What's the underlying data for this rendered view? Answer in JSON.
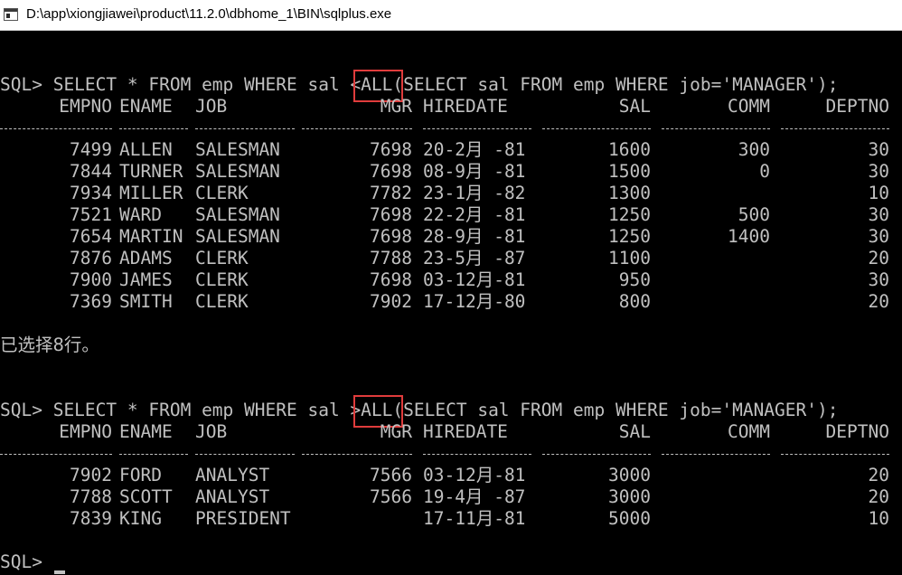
{
  "window": {
    "title": "D:\\app\\xiongjiawei\\product\\11.2.0\\dbhome_1\\BIN\\sqlplus.exe",
    "icon": "console-window-icon"
  },
  "queries": [
    {
      "prompt": "SQL> ",
      "pre": "SELECT * FROM emp WHERE sal ",
      "op": "<ALL",
      "post": "(SELECT sal FROM emp WHERE job='MANAGER');",
      "headers": {
        "empno": "EMPNO",
        "ename": "ENAME",
        "job": "JOB",
        "mgr": "MGR",
        "hiredate": "HIREDATE",
        "sal": "SAL",
        "comm": "COMM",
        "deptno": "DEPTNO"
      },
      "rows": [
        {
          "empno": "7499",
          "ename": "ALLEN",
          "job": "SALESMAN",
          "mgr": "7698",
          "hiredate": "20-2月 -81",
          "sal": "1600",
          "comm": "300",
          "deptno": "30"
        },
        {
          "empno": "7844",
          "ename": "TURNER",
          "job": "SALESMAN",
          "mgr": "7698",
          "hiredate": "08-9月 -81",
          "sal": "1500",
          "comm": "0",
          "deptno": "30"
        },
        {
          "empno": "7934",
          "ename": "MILLER",
          "job": "CLERK",
          "mgr": "7782",
          "hiredate": "23-1月 -82",
          "sal": "1300",
          "comm": "",
          "deptno": "10"
        },
        {
          "empno": "7521",
          "ename": "WARD",
          "job": "SALESMAN",
          "mgr": "7698",
          "hiredate": "22-2月 -81",
          "sal": "1250",
          "comm": "500",
          "deptno": "30"
        },
        {
          "empno": "7654",
          "ename": "MARTIN",
          "job": "SALESMAN",
          "mgr": "7698",
          "hiredate": "28-9月 -81",
          "sal": "1250",
          "comm": "1400",
          "deptno": "30"
        },
        {
          "empno": "7876",
          "ename": "ADAMS",
          "job": "CLERK",
          "mgr": "7788",
          "hiredate": "23-5月 -87",
          "sal": "1100",
          "comm": "",
          "deptno": "20"
        },
        {
          "empno": "7900",
          "ename": "JAMES",
          "job": "CLERK",
          "mgr": "7698",
          "hiredate": "03-12月-81",
          "sal": "950",
          "comm": "",
          "deptno": "30"
        },
        {
          "empno": "7369",
          "ename": "SMITH",
          "job": "CLERK",
          "mgr": "7902",
          "hiredate": "17-12月-80",
          "sal": "800",
          "comm": "",
          "deptno": "20"
        }
      ],
      "message": "已选择8行。"
    },
    {
      "prompt": "SQL> ",
      "pre": "SELECT * FROM emp WHERE sal ",
      "op": ">ALL",
      "post": "(SELECT sal FROM emp WHERE job='MANAGER');",
      "headers": {
        "empno": "EMPNO",
        "ename": "ENAME",
        "job": "JOB",
        "mgr": "MGR",
        "hiredate": "HIREDATE",
        "sal": "SAL",
        "comm": "COMM",
        "deptno": "DEPTNO"
      },
      "rows": [
        {
          "empno": "7902",
          "ename": "FORD",
          "job": "ANALYST",
          "mgr": "7566",
          "hiredate": "03-12月-81",
          "sal": "3000",
          "comm": "",
          "deptno": "20"
        },
        {
          "empno": "7788",
          "ename": "SCOTT",
          "job": "ANALYST",
          "mgr": "7566",
          "hiredate": "19-4月 -87",
          "sal": "3000",
          "comm": "",
          "deptno": "20"
        },
        {
          "empno": "7839",
          "ename": "KING",
          "job": "PRESIDENT",
          "mgr": "",
          "hiredate": "17-11月-81",
          "sal": "5000",
          "comm": "",
          "deptno": "10"
        }
      ]
    }
  ],
  "final_prompt": "SQL> ",
  "colors": {
    "terminal_bg": "#000000",
    "terminal_text": "#c0c0c0",
    "highlight_box": "#e03c3c"
  }
}
